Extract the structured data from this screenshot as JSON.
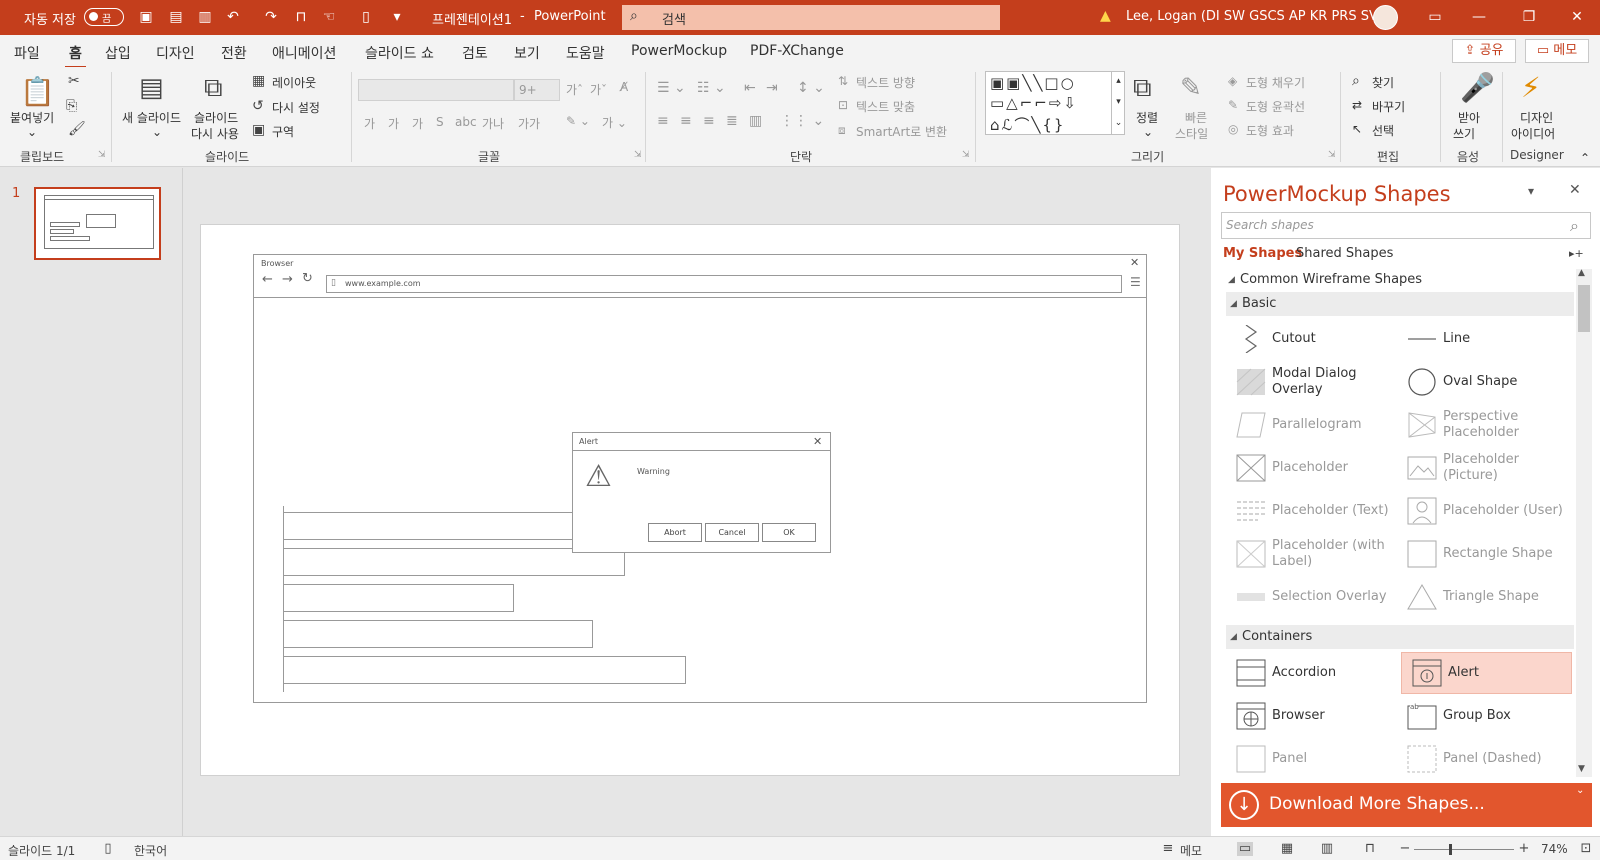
{
  "titlebar": {
    "autosave_label": "자동 저장",
    "autosave_state": "끔",
    "document_title": "프레젠테이션1",
    "app_name": "PowerPoint",
    "separator": "-",
    "search_placeholder": "검색",
    "user_name": "Lee, Logan (DI SW GSCS AP KR PRS SVC)"
  },
  "menu": {
    "tabs": [
      "파일",
      "홈",
      "삽입",
      "디자인",
      "전환",
      "애니메이션",
      "슬라이드 쇼",
      "검토",
      "보기",
      "도움말",
      "PowerMockup",
      "PDF-XChange"
    ],
    "active_tab": "홈",
    "share_label": "공유",
    "comments_label": "메모"
  },
  "ribbon": {
    "clipboard": {
      "paste_label": "붙여넣기",
      "group_label": "클립보드"
    },
    "slides": {
      "new_slide_line1": "새 슬라이드",
      "reuse_line1": "슬라이드",
      "reuse_line2": "다시 사용",
      "layout_label": "레이아웃",
      "reset_label": "다시 설정",
      "section_label": "구역",
      "group_label": "슬라이드"
    },
    "font": {
      "size_value": "9+",
      "group_label": "글꼴",
      "styles": [
        "가",
        "가",
        "가",
        "S",
        "abc",
        "가나",
        "가가"
      ]
    },
    "paragraph": {
      "text_direction": "텍스트 방향",
      "align_text": "텍스트 맞춤",
      "smartart": "SmartArt로 변환",
      "group_label": "단락"
    },
    "drawing": {
      "arrange_label": "정렬",
      "quick_styles_line1": "빠른",
      "quick_styles_line2": "스타일",
      "fill_label": "도형 채우기",
      "outline_label": "도형 윤곽선",
      "effects_label": "도형 효과",
      "group_label": "그리기"
    },
    "editing": {
      "find_label": "찾기",
      "replace_label": "바꾸기",
      "select_label": "선택",
      "group_label": "편집"
    },
    "voice": {
      "dictate_line1": "받아",
      "dictate_line2": "쓰기",
      "group_label": "음성"
    },
    "designer": {
      "line1": "디자인",
      "line2": "아이디어",
      "group_label": "Designer"
    }
  },
  "thumbnails": {
    "slide_number": "1"
  },
  "slide": {
    "browser_title": "Browser",
    "browser_url": "www.example.com",
    "alert_title": "Alert",
    "alert_message": "Warning",
    "buttons": [
      "Abort",
      "Cancel",
      "OK"
    ]
  },
  "pane": {
    "title": "PowerMockup Shapes",
    "search_placeholder": "Search shapes",
    "tab_my": "My Shapes",
    "tab_shared": "Shared Shapes",
    "category": "Common Wireframe Shapes",
    "basic": {
      "header": "Basic",
      "items": [
        [
          "Cutout",
          "Line"
        ],
        [
          "Modal Dialog Overlay",
          "Oval Shape"
        ],
        [
          "Parallelogram",
          "Perspective Placeholder"
        ],
        [
          "Placeholder",
          "Placeholder (Picture)"
        ],
        [
          "Placeholder (Text)",
          "Placeholder (User)"
        ],
        [
          "Placeholder (with Label)",
          "Rectangle Shape"
        ],
        [
          "Selection Overlay",
          "Triangle Shape"
        ]
      ]
    },
    "containers": {
      "header": "Containers",
      "items": [
        [
          "Accordion",
          "Alert"
        ],
        [
          "Browser",
          "Group Box"
        ],
        [
          "Panel",
          "Panel (Dashed)"
        ]
      ]
    },
    "download_label": "Download More Shapes..."
  },
  "status": {
    "slide_indicator": "슬라이드 1/1",
    "language": "한국어",
    "notes_label": "메모",
    "zoom": "74%"
  },
  "colors": {
    "accent": "#c43e1c",
    "download": "#e2562d",
    "selected": "#fbd6cc"
  }
}
